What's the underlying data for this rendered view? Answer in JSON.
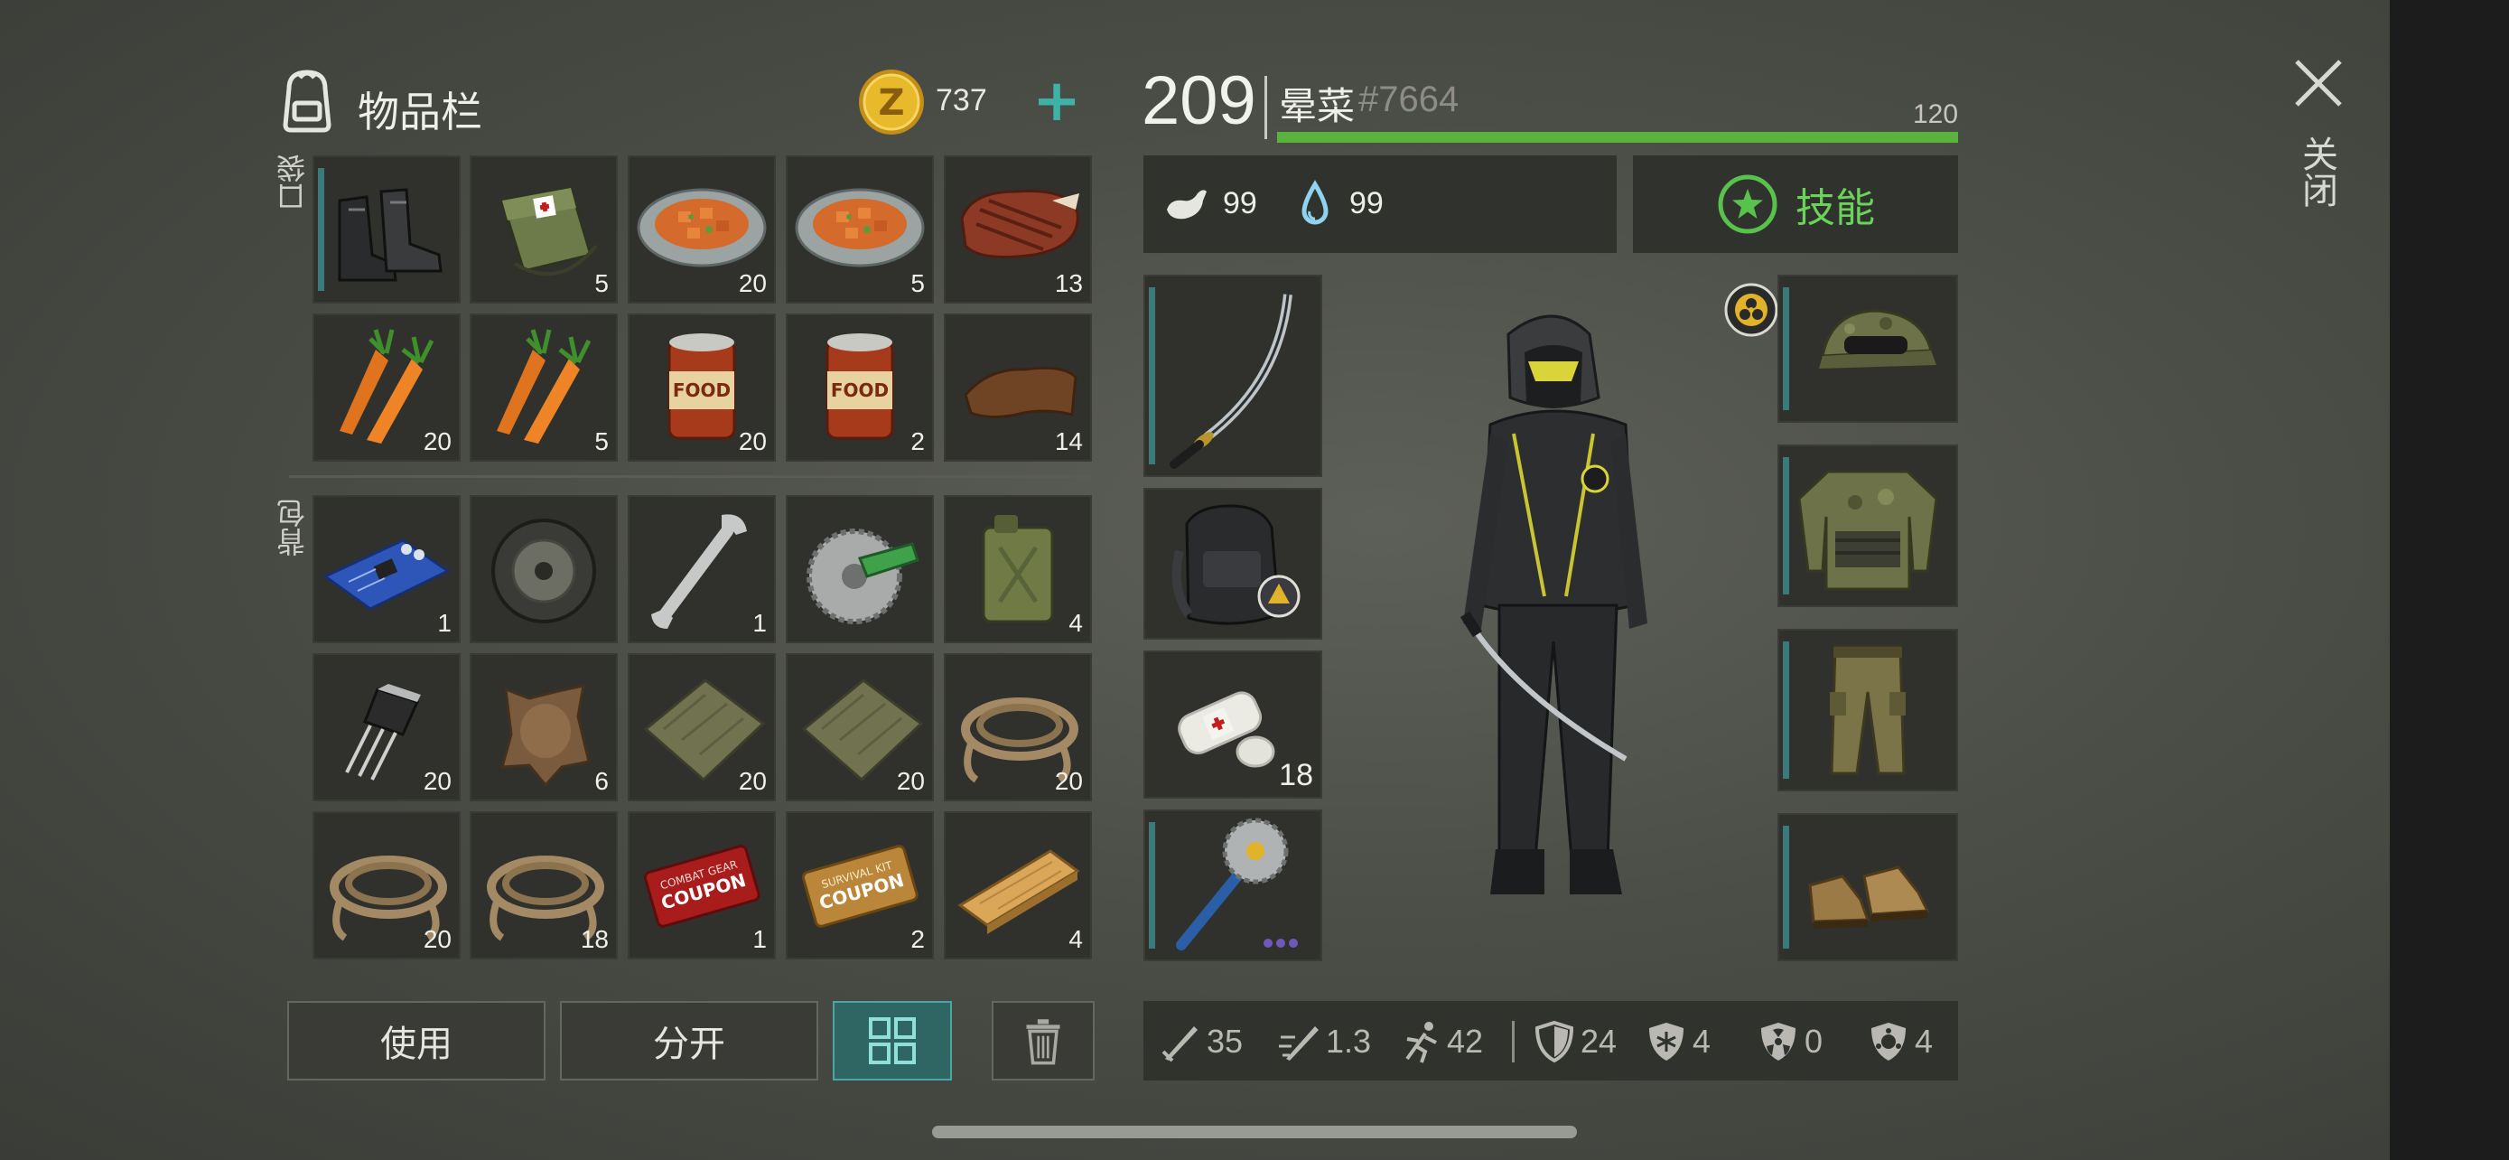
{
  "inventory": {
    "title": "物品栏",
    "pocket_label": "口袋",
    "backpack_label": "背包",
    "pocket_items": [
      {
        "name": "boots",
        "count": ""
      },
      {
        "name": "medkit-bag",
        "count": "5"
      },
      {
        "name": "stew-plate",
        "count": "20"
      },
      {
        "name": "stew-plate",
        "count": "5"
      },
      {
        "name": "steak",
        "count": "13"
      },
      {
        "name": "carrots",
        "count": "20"
      },
      {
        "name": "carrots",
        "count": "5"
      },
      {
        "name": "food-can",
        "count": "20"
      },
      {
        "name": "food-can",
        "count": "2"
      },
      {
        "name": "leather",
        "count": "14"
      }
    ],
    "backpack_items": [
      {
        "name": "circuit-board",
        "count": "1"
      },
      {
        "name": "wheel",
        "count": ""
      },
      {
        "name": "wrench",
        "count": "1"
      },
      {
        "name": "saw-blade",
        "count": ""
      },
      {
        "name": "jerrycan",
        "count": "4"
      },
      {
        "name": "transistor",
        "count": "20"
      },
      {
        "name": "hide",
        "count": "6"
      },
      {
        "name": "cloth",
        "count": "20"
      },
      {
        "name": "cloth",
        "count": "20"
      },
      {
        "name": "rope",
        "count": "20"
      },
      {
        "name": "rope",
        "count": "20"
      },
      {
        "name": "rope",
        "count": "18"
      },
      {
        "name": "combat-gear-coupon",
        "count": "1"
      },
      {
        "name": "survival-kit-coupon",
        "count": "2"
      },
      {
        "name": "wood-plank",
        "count": "4"
      }
    ],
    "coupon_combat": [
      "COMBAT GEAR",
      "COUPON"
    ],
    "coupon_survival": [
      "SURVIVAL KIT",
      "COUPON"
    ],
    "can_label": "FOOD"
  },
  "currency": {
    "amount": "737",
    "add_label": "+",
    "coin_letter": "Z"
  },
  "buttons": {
    "use": "使用",
    "split": "分开"
  },
  "player": {
    "level": "209",
    "name": "晕菜",
    "tag": "#7664",
    "xp_max": "120",
    "xp_fraction": 1.0,
    "hunger": "99",
    "thirst": "99",
    "skills_label": "技能"
  },
  "equipment": {
    "bandage_count": "18"
  },
  "stats": [
    {
      "icon": "damage-icon",
      "value": "35"
    },
    {
      "icon": "attack-speed-icon",
      "value": "1.3"
    },
    {
      "icon": "speed-icon",
      "value": "42"
    },
    {
      "icon": "armor-icon",
      "value": "24"
    },
    {
      "icon": "cold-resist-icon",
      "value": "4"
    },
    {
      "icon": "radiation-resist-icon",
      "value": "0"
    },
    {
      "icon": "infection-resist-icon",
      "value": "4"
    }
  ],
  "close_label": "关闭",
  "colors": {
    "accent_teal": "#3a7a7a",
    "xp_green": "#5ab43c",
    "skill_green": "#58c24c",
    "coin_gold": "#e0b32a"
  }
}
